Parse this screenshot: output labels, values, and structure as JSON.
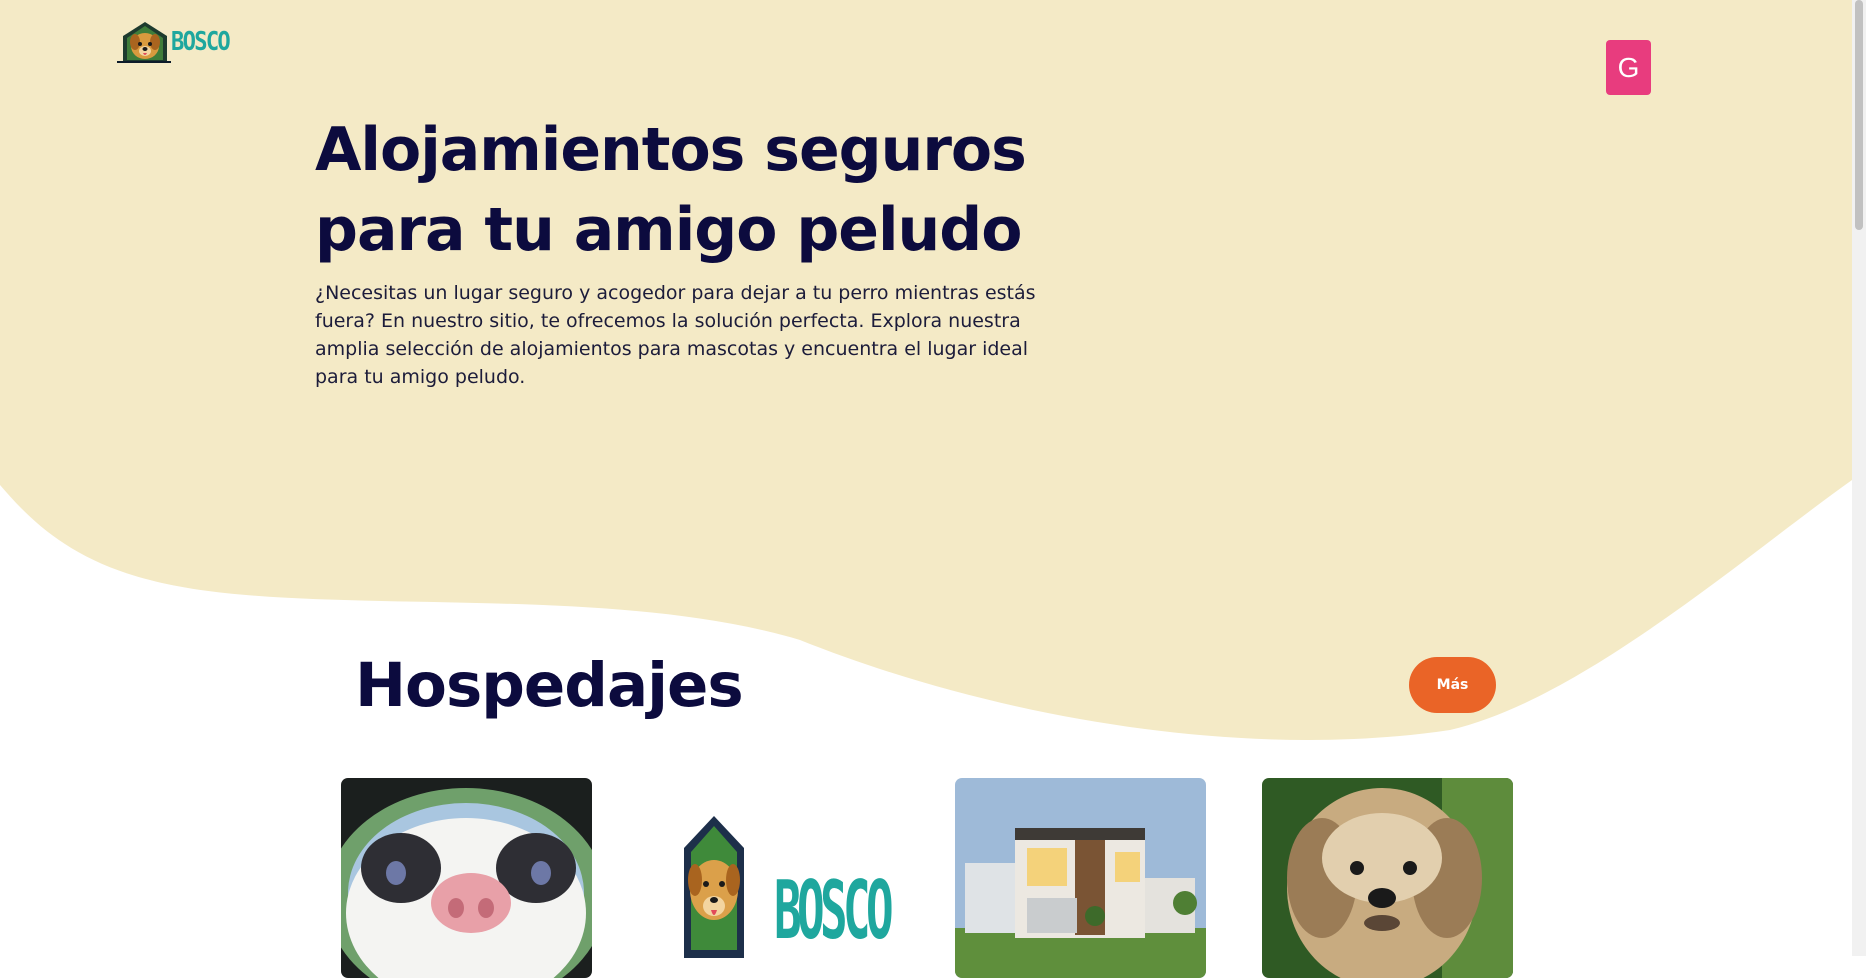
{
  "brand": {
    "name": "BOSCO",
    "logo_icon": "dog-house-logo-icon"
  },
  "header": {
    "avatar_initial": "G"
  },
  "hero": {
    "title_line1": "Alojamientos seguros",
    "title_line2": "para tu amigo peludo",
    "description": "¿Necesitas un lugar seguro y acogedor para dejar a tu perro mientras estás fuera? En nuestro sitio, te ofrecemos la solución perfecta. Explora nuestra amplia selección de alojamientos para mascotas y encuentra el lugar ideal para tu amigo peludo."
  },
  "section": {
    "title": "Hospedajes",
    "more_label": "Más"
  },
  "cards": [
    {
      "image": "cat-closeup-photo"
    },
    {
      "image": "bosco-logo-image",
      "logo_text": "BOSCO"
    },
    {
      "image": "modern-house-photo"
    },
    {
      "image": "small-dog-photo"
    }
  ],
  "colors": {
    "hero_background": "#f4eac6",
    "heading": "#0c0b3e",
    "avatar": "#e83c7e",
    "more_button": "#ea6427",
    "brand_teal": "#1fa79e"
  }
}
